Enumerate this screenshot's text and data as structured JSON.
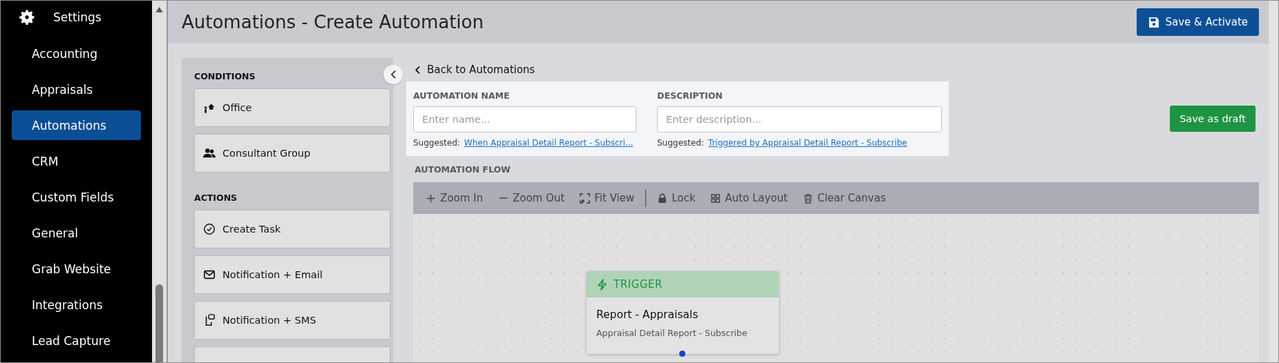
{
  "sidebar": {
    "header": "Settings",
    "items": [
      {
        "label": "Accounting",
        "selected": false
      },
      {
        "label": "Appraisals",
        "selected": false
      },
      {
        "label": "Automations",
        "selected": true
      },
      {
        "label": "CRM",
        "selected": false
      },
      {
        "label": "Custom Fields",
        "selected": false
      },
      {
        "label": "General",
        "selected": false
      },
      {
        "label": "Grab Website",
        "selected": false
      },
      {
        "label": "Integrations",
        "selected": false
      },
      {
        "label": "Lead Capture",
        "selected": false
      }
    ]
  },
  "page": {
    "title": "Automations - Create Automation",
    "primary_button": "Save & Activate"
  },
  "palette": {
    "sections": [
      {
        "heading": "CONDITIONS",
        "items": [
          {
            "label": "Office",
            "kind": "office"
          },
          {
            "label": "Consultant Group",
            "kind": "group"
          }
        ]
      },
      {
        "heading": "ACTIONS",
        "items": [
          {
            "label": "Create Task",
            "kind": "task"
          },
          {
            "label": "Notification + Email",
            "kind": "email"
          },
          {
            "label": "Notification + SMS",
            "kind": "sms"
          },
          {
            "kind": "blank"
          }
        ]
      }
    ]
  },
  "back_link": "Back to Automations",
  "form": {
    "fields": [
      {
        "label": "AUTOMATION NAME",
        "placeholder": "Enter name...",
        "suggested_label": "Suggested:",
        "suggestion": "When Appraisal Detail Report - Subscri..."
      },
      {
        "label": "DESCRIPTION",
        "placeholder": "Enter description...",
        "suggested_label": "Suggested:",
        "suggestion": "Triggered by Appraisal Detail Report - Subscribe"
      }
    ]
  },
  "draft_button": "Save as draft",
  "flow": {
    "label": "AUTOMATION FLOW",
    "toolbar_groups": [
      [
        {
          "label": "Zoom In",
          "kind": "plus"
        },
        {
          "label": "Zoom Out",
          "kind": "minus"
        },
        {
          "label": "Fit View",
          "kind": "fit"
        }
      ],
      [
        {
          "label": "Lock",
          "kind": "lock"
        },
        {
          "label": "Auto Layout",
          "kind": "grid"
        },
        {
          "label": "Clear Canvas",
          "kind": "trash"
        }
      ]
    ],
    "node": {
      "badge": "TRIGGER",
      "title": "Report - Appraisals",
      "subtitle": "Appraisal Detail Report - Subscribe"
    }
  }
}
